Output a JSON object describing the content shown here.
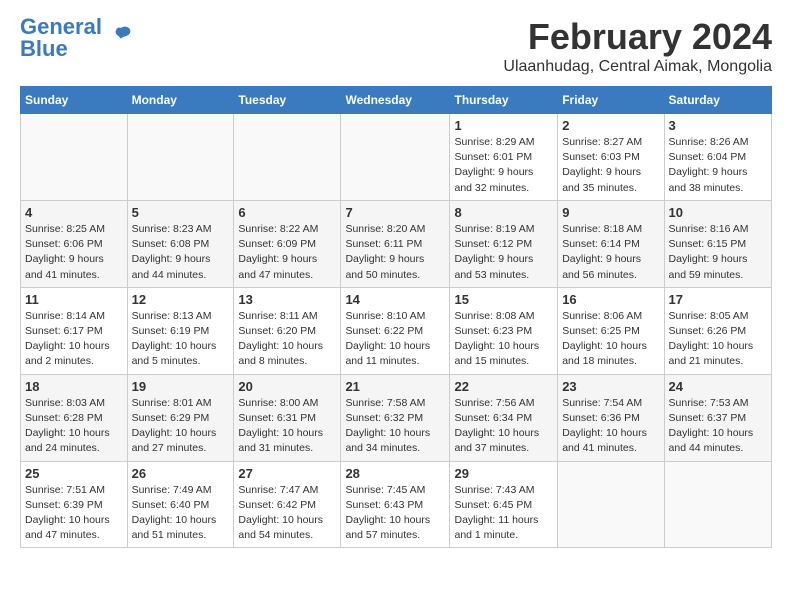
{
  "header": {
    "logo_general": "General",
    "logo_blue": "Blue",
    "title": "February 2024",
    "subtitle": "Ulaanhudag, Central Aimak, Mongolia"
  },
  "days_of_week": [
    "Sunday",
    "Monday",
    "Tuesday",
    "Wednesday",
    "Thursday",
    "Friday",
    "Saturday"
  ],
  "weeks": [
    [
      {
        "day": "",
        "info": ""
      },
      {
        "day": "",
        "info": ""
      },
      {
        "day": "",
        "info": ""
      },
      {
        "day": "",
        "info": ""
      },
      {
        "day": "1",
        "info": "Sunrise: 8:29 AM\nSunset: 6:01 PM\nDaylight: 9 hours\nand 32 minutes."
      },
      {
        "day": "2",
        "info": "Sunrise: 8:27 AM\nSunset: 6:03 PM\nDaylight: 9 hours\nand 35 minutes."
      },
      {
        "day": "3",
        "info": "Sunrise: 8:26 AM\nSunset: 6:04 PM\nDaylight: 9 hours\nand 38 minutes."
      }
    ],
    [
      {
        "day": "4",
        "info": "Sunrise: 8:25 AM\nSunset: 6:06 PM\nDaylight: 9 hours\nand 41 minutes."
      },
      {
        "day": "5",
        "info": "Sunrise: 8:23 AM\nSunset: 6:08 PM\nDaylight: 9 hours\nand 44 minutes."
      },
      {
        "day": "6",
        "info": "Sunrise: 8:22 AM\nSunset: 6:09 PM\nDaylight: 9 hours\nand 47 minutes."
      },
      {
        "day": "7",
        "info": "Sunrise: 8:20 AM\nSunset: 6:11 PM\nDaylight: 9 hours\nand 50 minutes."
      },
      {
        "day": "8",
        "info": "Sunrise: 8:19 AM\nSunset: 6:12 PM\nDaylight: 9 hours\nand 53 minutes."
      },
      {
        "day": "9",
        "info": "Sunrise: 8:18 AM\nSunset: 6:14 PM\nDaylight: 9 hours\nand 56 minutes."
      },
      {
        "day": "10",
        "info": "Sunrise: 8:16 AM\nSunset: 6:15 PM\nDaylight: 9 hours\nand 59 minutes."
      }
    ],
    [
      {
        "day": "11",
        "info": "Sunrise: 8:14 AM\nSunset: 6:17 PM\nDaylight: 10 hours\nand 2 minutes."
      },
      {
        "day": "12",
        "info": "Sunrise: 8:13 AM\nSunset: 6:19 PM\nDaylight: 10 hours\nand 5 minutes."
      },
      {
        "day": "13",
        "info": "Sunrise: 8:11 AM\nSunset: 6:20 PM\nDaylight: 10 hours\nand 8 minutes."
      },
      {
        "day": "14",
        "info": "Sunrise: 8:10 AM\nSunset: 6:22 PM\nDaylight: 10 hours\nand 11 minutes."
      },
      {
        "day": "15",
        "info": "Sunrise: 8:08 AM\nSunset: 6:23 PM\nDaylight: 10 hours\nand 15 minutes."
      },
      {
        "day": "16",
        "info": "Sunrise: 8:06 AM\nSunset: 6:25 PM\nDaylight: 10 hours\nand 18 minutes."
      },
      {
        "day": "17",
        "info": "Sunrise: 8:05 AM\nSunset: 6:26 PM\nDaylight: 10 hours\nand 21 minutes."
      }
    ],
    [
      {
        "day": "18",
        "info": "Sunrise: 8:03 AM\nSunset: 6:28 PM\nDaylight: 10 hours\nand 24 minutes."
      },
      {
        "day": "19",
        "info": "Sunrise: 8:01 AM\nSunset: 6:29 PM\nDaylight: 10 hours\nand 27 minutes."
      },
      {
        "day": "20",
        "info": "Sunrise: 8:00 AM\nSunset: 6:31 PM\nDaylight: 10 hours\nand 31 minutes."
      },
      {
        "day": "21",
        "info": "Sunrise: 7:58 AM\nSunset: 6:32 PM\nDaylight: 10 hours\nand 34 minutes."
      },
      {
        "day": "22",
        "info": "Sunrise: 7:56 AM\nSunset: 6:34 PM\nDaylight: 10 hours\nand 37 minutes."
      },
      {
        "day": "23",
        "info": "Sunrise: 7:54 AM\nSunset: 6:36 PM\nDaylight: 10 hours\nand 41 minutes."
      },
      {
        "day": "24",
        "info": "Sunrise: 7:53 AM\nSunset: 6:37 PM\nDaylight: 10 hours\nand 44 minutes."
      }
    ],
    [
      {
        "day": "25",
        "info": "Sunrise: 7:51 AM\nSunset: 6:39 PM\nDaylight: 10 hours\nand 47 minutes."
      },
      {
        "day": "26",
        "info": "Sunrise: 7:49 AM\nSunset: 6:40 PM\nDaylight: 10 hours\nand 51 minutes."
      },
      {
        "day": "27",
        "info": "Sunrise: 7:47 AM\nSunset: 6:42 PM\nDaylight: 10 hours\nand 54 minutes."
      },
      {
        "day": "28",
        "info": "Sunrise: 7:45 AM\nSunset: 6:43 PM\nDaylight: 10 hours\nand 57 minutes."
      },
      {
        "day": "29",
        "info": "Sunrise: 7:43 AM\nSunset: 6:45 PM\nDaylight: 11 hours\nand 1 minute."
      },
      {
        "day": "",
        "info": ""
      },
      {
        "day": "",
        "info": ""
      }
    ]
  ]
}
